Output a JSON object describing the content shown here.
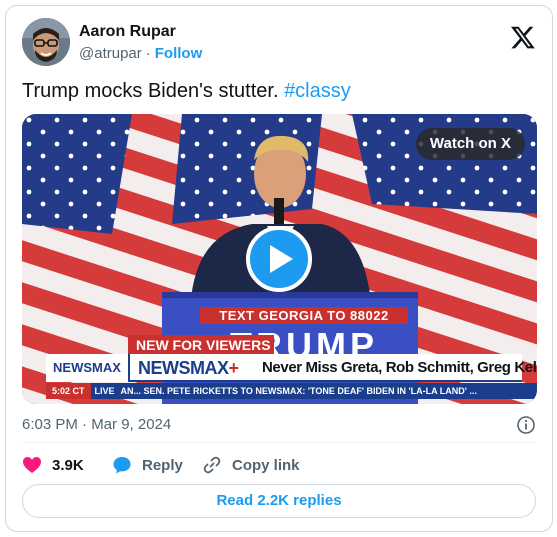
{
  "author": {
    "name": "Aaron Rupar",
    "handle": "@atrupar",
    "separator": "·",
    "follow_label": "Follow"
  },
  "tweet": {
    "text": "Trump mocks Biden's stutter.",
    "hashtag": "#classy",
    "timestamp": "6:03 PM · Mar 9, 2024"
  },
  "media": {
    "watch_label": "Watch on X",
    "podium_sub": "TEXT GEORGIA TO 88022",
    "podium_big": "TRUMP",
    "new_for_viewers": "NEW FOR VIEWERS",
    "channel_logo": "NEWSMAX",
    "brand": "NEWSMAX",
    "brand_plus": "+",
    "headline": "Never Miss Greta, Rob Schmitt, Greg Kelly",
    "ticker_time": "5:02 CT",
    "ticker_live": "LIVE",
    "ticker_text": "AN...   SEN. PETE RICKETTS TO NEWSMAX: 'TONE DEAF' BIDEN IN 'LA-LA LAND' ..."
  },
  "actions": {
    "likes": "3.9K",
    "reply_label": "Reply",
    "copy_label": "Copy link"
  },
  "read_replies_label": "Read 2.2K replies",
  "colors": {
    "accent": "#1d9bf0",
    "like": "#f91880",
    "text": "#0f1419",
    "muted": "#536471",
    "border": "#cfd9de"
  },
  "icons": [
    "x-logo-icon",
    "play-icon",
    "info-icon",
    "heart-icon",
    "reply-bubble-icon",
    "link-icon"
  ]
}
